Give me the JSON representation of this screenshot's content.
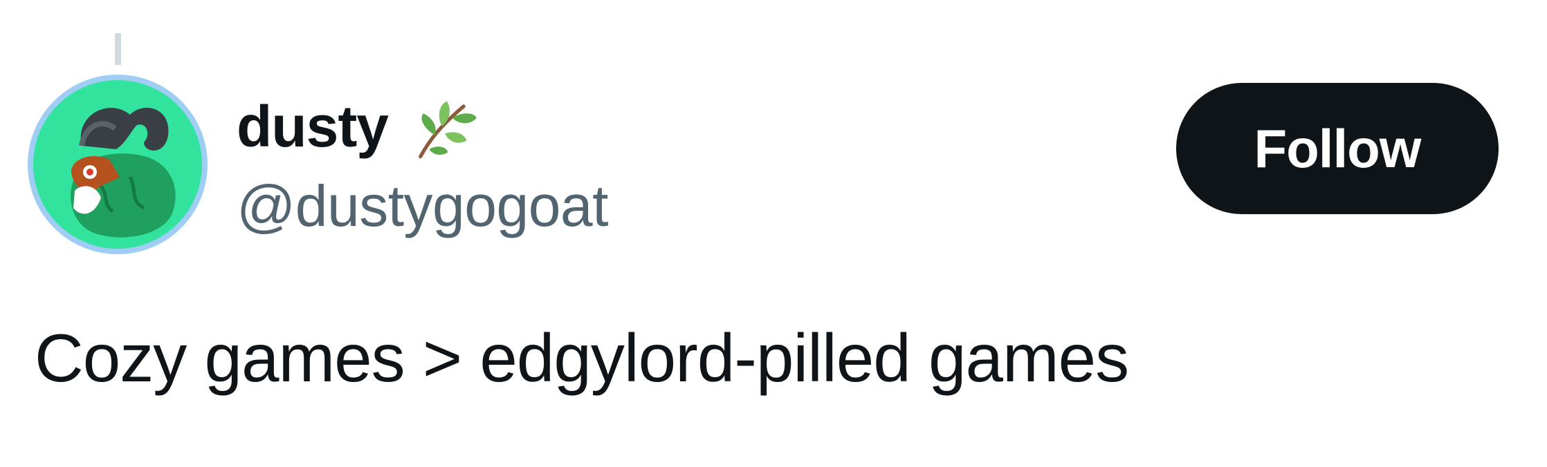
{
  "author": {
    "display_name": "dusty",
    "handle": "@dustygogoat",
    "avatar_icon": "goat-avatar-icon",
    "name_emoji": "leaf-branch-icon"
  },
  "actions": {
    "follow_label": "Follow"
  },
  "tweet": {
    "text": "Cozy games > edgylord-pilled games"
  },
  "colors": {
    "follow_bg": "#0f1419",
    "handle": "#536471",
    "text": "#0f1419",
    "avatar_bg": "#31e39c",
    "avatar_ring": "#9fcdf4"
  }
}
